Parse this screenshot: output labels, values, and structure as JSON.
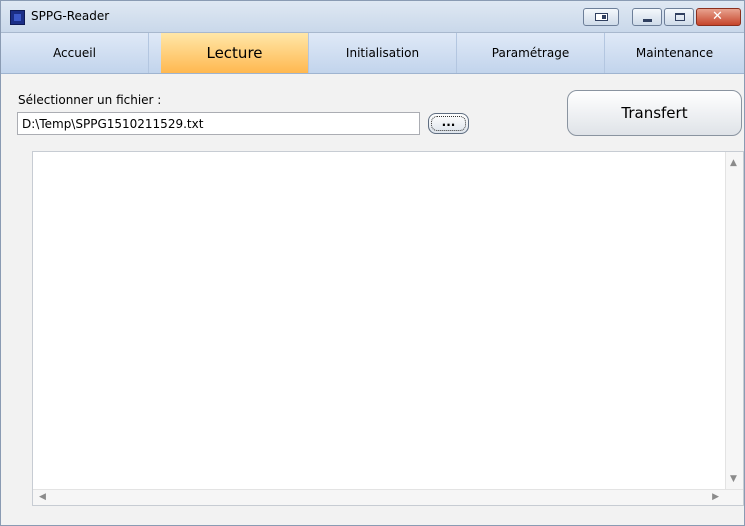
{
  "window": {
    "title": "SPPG-Reader"
  },
  "tabs": [
    {
      "label": "Accueil"
    },
    {
      "label": "Lecture",
      "active": true
    },
    {
      "label": "Initialisation"
    },
    {
      "label": "Paramétrage"
    },
    {
      "label": "Maintenance"
    }
  ],
  "file": {
    "label": "Sélectionner un fichier :",
    "path": "D:\\Temp\\SPPG1510211529.txt",
    "browse_label": "..."
  },
  "transfer": {
    "label": "Transfert"
  },
  "icons": {
    "up": "▲",
    "down": "▼",
    "left": "◀",
    "right": "▶",
    "close": "✕"
  },
  "colors": {
    "active_tab": "#ffb850",
    "tab_bar": "#c2d4ec",
    "close_button": "#c6452b"
  }
}
